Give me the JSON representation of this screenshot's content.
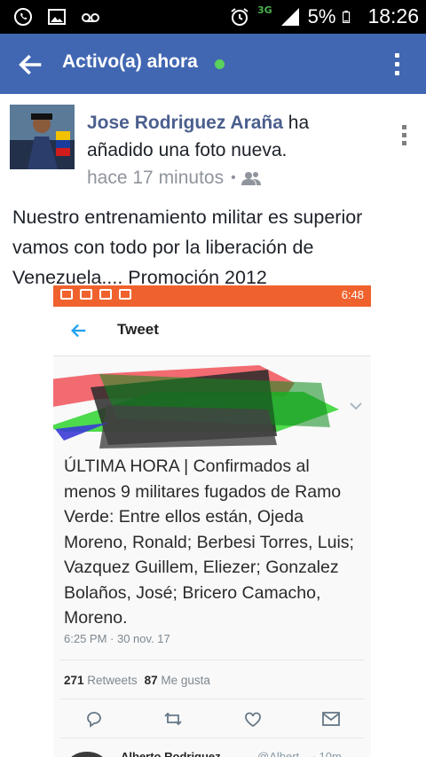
{
  "status_bar": {
    "network": "3G",
    "battery": "5%",
    "time": "18:26",
    "icons": [
      "whatsapp-icon",
      "image-icon",
      "voicemail-icon",
      "alarm-icon",
      "signal-icon",
      "battery-icon"
    ]
  },
  "header": {
    "title": "Activo(a) ahora",
    "online_color": "#5bd25b",
    "bar_color": "#4267b2"
  },
  "post": {
    "author": "Jose Rodriguez Araña",
    "action": " ha añadido una foto nueva.",
    "time": "hace 17 minutos",
    "separator": "•",
    "text": "Nuestro entrenamiento militar es superior vamos con todo por la liberación de Venezuela.... Promoción 2012"
  },
  "photo": {
    "status_time": "6:48",
    "screen_title": "Tweet",
    "tweet_text": "ÚLTIMA HORA | Confirmados al menos 9 militares fugados de Ramo Verde: Entre ellos están, Ojeda Moreno, Ronald; Berbesi Torres, Luis; Vazquez Guillem, Eliezer; Gonzalez Bolaños, José; Bricero Camacho, Moreno.",
    "tweet_time": "6:25 PM · 30 nov. 17",
    "retweets_count": "271",
    "retweets_label": "Retweets",
    "likes_count": "87",
    "likes_label": "Me gusta",
    "reply_name": "Alberto Rodriguez",
    "reply_handle": "@Albert... · 10m",
    "accent_color": "#f0622d"
  }
}
